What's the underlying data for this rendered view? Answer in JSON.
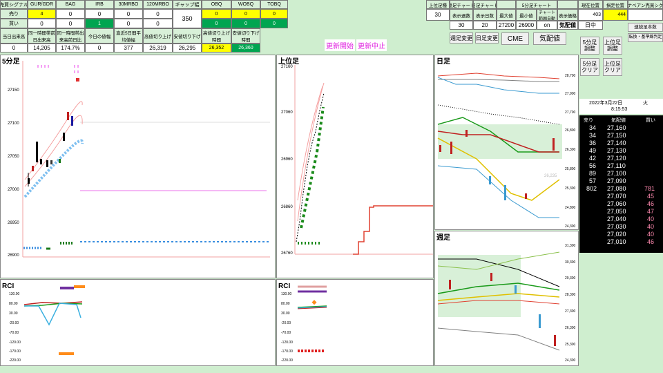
{
  "top_table": {
    "headers": [
      "売買シグナル",
      "GUR/GDR",
      "BAG",
      "IRB",
      "30MRBO",
      "120MRBO",
      "ギャップ幅",
      "OBQ",
      "WOBQ",
      "TOBQ"
    ],
    "row1_label": "売り",
    "row1": [
      "4",
      "0",
      "0",
      "0",
      "0",
      "",
      "0",
      "0",
      "0"
    ],
    "row2_label": "買い",
    "row2": [
      "0",
      "0",
      "1",
      "0",
      "0",
      "",
      "0",
      "0",
      "0"
    ],
    "gap_value": "350",
    "stat_headers": [
      "当日出来高",
      "同一時間帯前日出来高",
      "同一時間帯出来高前日比",
      "今日の値幅",
      "直近5日間平均値幅",
      "高値切り上げ",
      "安値切り下げ",
      "高値切り上げ時間",
      "安値切り下げ時間"
    ],
    "stat_values": [
      "0",
      "14,205",
      "174.7%",
      "0",
      "377",
      "26,319",
      "26,295",
      "26,352",
      "26,360"
    ]
  },
  "right_table": {
    "headers": [
      "上位足種",
      "隠足チャート",
      "日足チャート",
      "",
      "5分足チャート",
      "",
      "",
      "現在位置",
      "損定位置",
      "ナベアン売買シグ"
    ],
    "sub_headers": [
      "表示週数",
      "表示日数",
      "最大値",
      "最小値",
      "チャート範囲自動",
      "表示価格"
    ],
    "values": [
      "30",
      "30",
      "20",
      "27200",
      "26900",
      "on",
      "気配値",
      "日中"
    ],
    "pos_current": "403",
    "pos_stop": "444"
  },
  "buttons": {
    "update_start": "更新開始",
    "update_stop": "更新中止",
    "week_change": "週足変更",
    "day_change": "日足変更",
    "cme": "CME",
    "quote": "気配値",
    "five_adjust": "5分足調整",
    "upper_adjust": "上位足調整",
    "five_clear": "5分足クリア",
    "upper_clear": "上位足クリア",
    "trend_count": "連続足本数",
    "conversion": "転換・基準線判定"
  },
  "panels": {
    "five_min": "5分足",
    "upper": "上位足",
    "daily": "日足",
    "weekly": "週足",
    "rci": "RCI"
  },
  "five_yaxis": [
    "27150",
    "27100",
    "27050",
    "27000",
    "26950",
    "26900"
  ],
  "upper_yaxis": [
    "27160",
    "27060",
    "26960",
    "26860",
    "26760"
  ],
  "daily_yaxis": [
    "28,700",
    "27,900",
    "27,700",
    "26,800",
    "26,300",
    "25,800",
    "25,300",
    "24,800",
    "24,300"
  ],
  "weekly_yaxis": [
    "31,300",
    "30,300",
    "29,300",
    "28,300",
    "27,300",
    "26,300",
    "25,300",
    "24,300"
  ],
  "rci_yaxis": [
    "130.00",
    "80.00",
    "30.00",
    "-20.00",
    "-70.00",
    "-120.00",
    "-170.00",
    "-220.00"
  ],
  "rci2_yaxis": [
    "130.00",
    "80.00",
    "30.00",
    "-20.00",
    "-70.00",
    "-120.00",
    "-170.00",
    "-220.00"
  ],
  "daily_price_tag": "26,235",
  "orderbook": {
    "date": "2022年3月22日",
    "weekday": "火",
    "time": "8:15:53",
    "headers": [
      "売り",
      "気配値",
      "買い"
    ],
    "rows": [
      [
        "34",
        "27,160",
        ""
      ],
      [
        "34",
        "27,150",
        ""
      ],
      [
        "36",
        "27,140",
        ""
      ],
      [
        "49",
        "27,130",
        ""
      ],
      [
        "42",
        "27,120",
        ""
      ],
      [
        "56",
        "27,110",
        ""
      ],
      [
        "89",
        "27,100",
        ""
      ],
      [
        "57",
        "27,090",
        ""
      ],
      [
        "802",
        "27,080",
        "781"
      ],
      [
        "",
        "27,070",
        "45"
      ],
      [
        "",
        "27,060",
        "46"
      ],
      [
        "",
        "27,050",
        "47"
      ],
      [
        "",
        "27,040",
        "40"
      ],
      [
        "",
        "27,030",
        "40"
      ],
      [
        "",
        "27,020",
        "40"
      ],
      [
        "",
        "27,010",
        "46"
      ]
    ]
  }
}
